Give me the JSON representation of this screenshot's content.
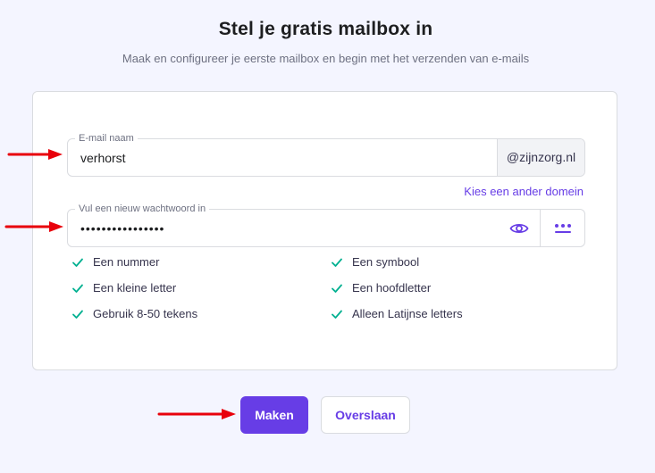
{
  "header": {
    "title": "Stel je gratis mailbox in",
    "subtitle": "Maak en configureer je eerste mailbox en begin met het verzenden van e-mails"
  },
  "form": {
    "email": {
      "label": "E-mail naam",
      "value": "verhorst",
      "domain": "@zijnzorg.nl"
    },
    "change_domain_label": "Kies een ander domein",
    "password": {
      "label": "Vul een nieuw wachtwoord in",
      "value": "••••••••••••••••"
    },
    "requirements": [
      "Een nummer",
      "Een symbool",
      "Een kleine letter",
      "Een hoofdletter",
      "Gebruik 8-50 tekens",
      "Alleen Latijnse letters"
    ]
  },
  "actions": {
    "create_label": "Maken",
    "skip_label": "Overslaan"
  },
  "colors": {
    "accent": "#673de6",
    "check": "#00b090",
    "annotation_arrow": "#e8000b"
  },
  "icons": {
    "show_password": "eye-icon",
    "generate_password": "dots-icon",
    "requirement_met": "check-icon"
  }
}
